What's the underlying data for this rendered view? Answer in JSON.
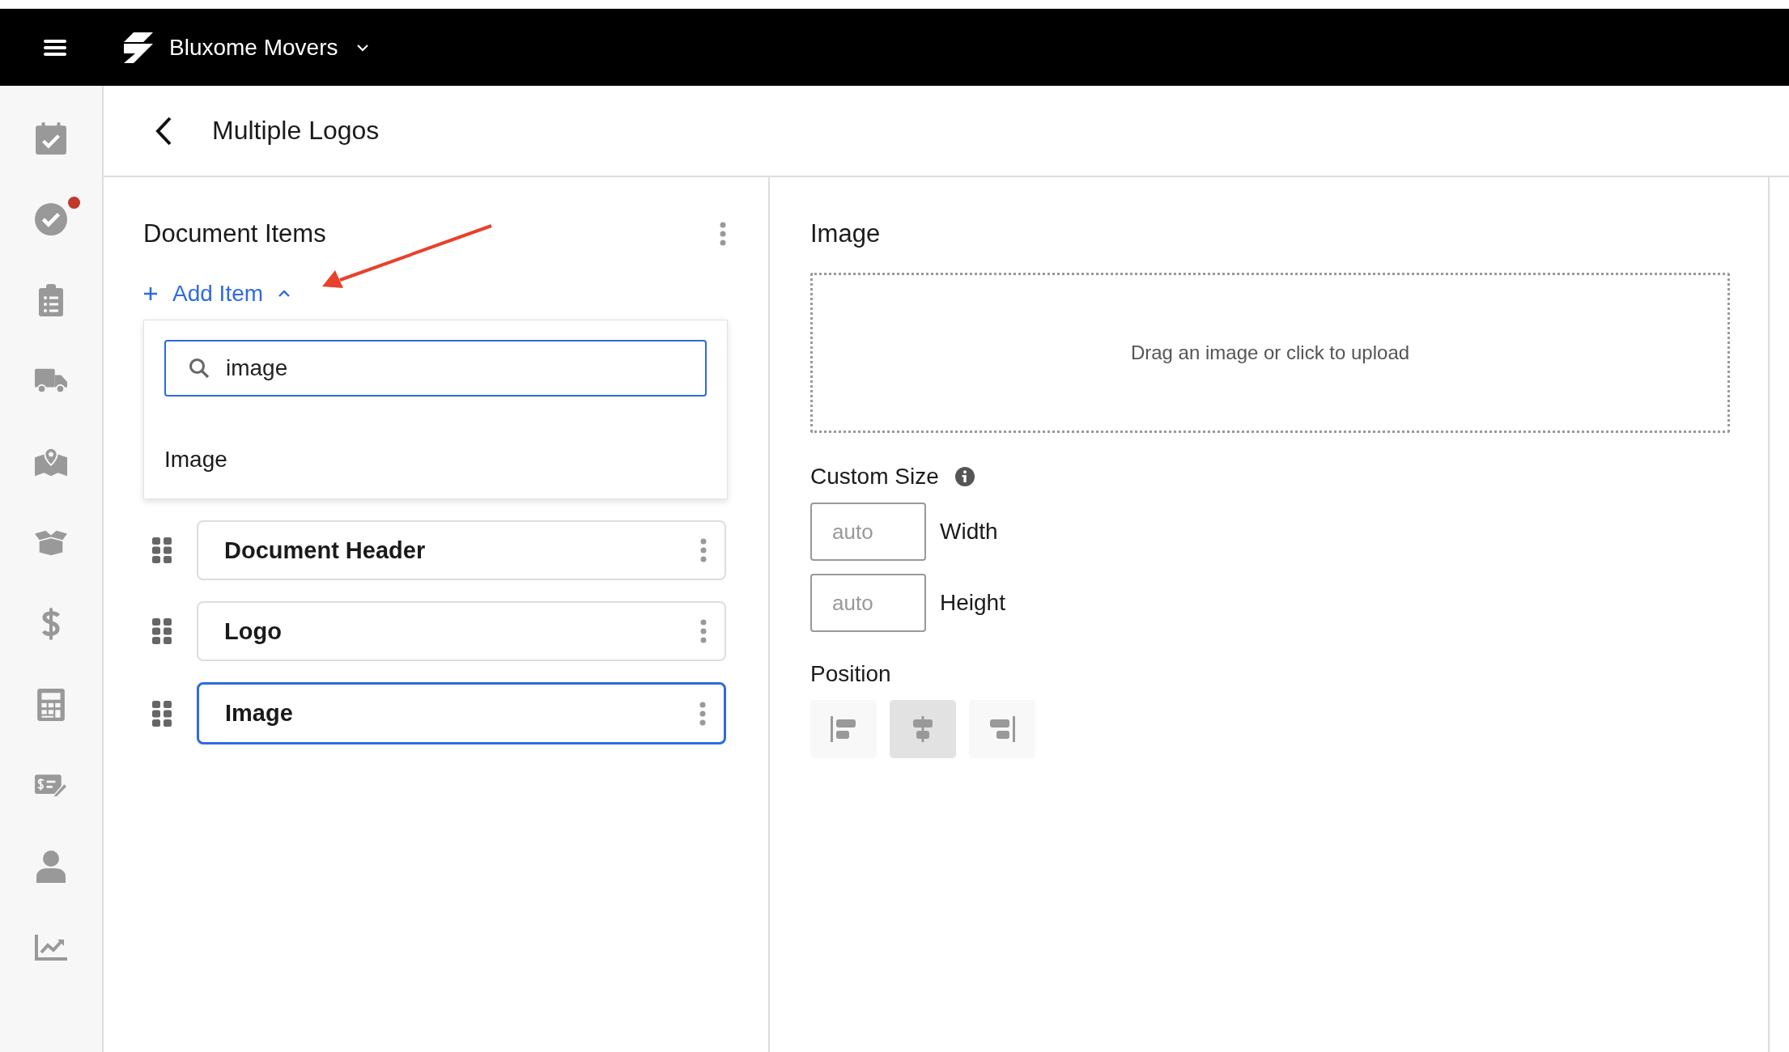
{
  "top_bar": {
    "brand": "Bluxome Movers"
  },
  "sidebar": {
    "items": [
      {
        "kind": "calendar",
        "notification": false
      },
      {
        "kind": "check",
        "notification": true
      },
      {
        "kind": "clipboard",
        "notification": false
      },
      {
        "kind": "truck",
        "notification": false
      },
      {
        "kind": "map",
        "notification": false
      },
      {
        "kind": "box",
        "notification": false
      },
      {
        "kind": "dollar",
        "notification": false
      },
      {
        "kind": "calculator",
        "notification": false
      },
      {
        "kind": "invoice",
        "notification": false
      },
      {
        "kind": "person",
        "notification": false
      },
      {
        "kind": "chart",
        "notification": false
      }
    ]
  },
  "header": {
    "title": "Multiple Logos"
  },
  "document_items": {
    "title": "Document Items",
    "add_item": "Add Item",
    "expanded": true,
    "search": {
      "value": "image"
    },
    "results": [
      "Image"
    ],
    "items": [
      {
        "label": "Document Header",
        "selected": false
      },
      {
        "label": "Logo",
        "selected": false
      },
      {
        "label": "Image",
        "selected": true
      }
    ]
  },
  "image_panel": {
    "title": "Image",
    "upload_hint": "Drag an image or click to upload",
    "custom_size": {
      "label": "Custom Size",
      "fields": [
        {
          "placeholder": "auto",
          "label": "Width"
        },
        {
          "placeholder": "auto",
          "label": "Height"
        }
      ]
    },
    "position": {
      "label": "Position",
      "options": [
        {
          "kind": "left",
          "selected": false
        },
        {
          "kind": "center",
          "selected": true
        },
        {
          "kind": "right",
          "selected": false
        }
      ]
    }
  }
}
